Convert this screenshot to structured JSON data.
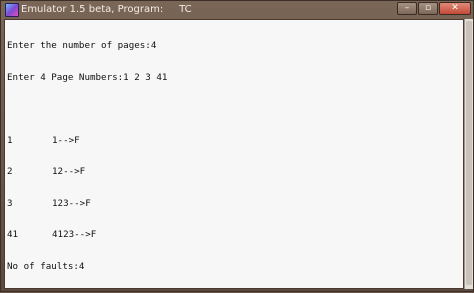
{
  "window": {
    "title": "Emulator 1.5 beta, Program:     TC",
    "controls": {
      "minimize": "–",
      "maximize": "▫",
      "close": "✕"
    }
  },
  "console": {
    "line1": "Enter the number of pages:4",
    "line2": "Enter 4 Page Numbers:1 2 3 41",
    "line3": "",
    "rows": [
      {
        "page": "1",
        "frames": "1-->F"
      },
      {
        "page": "2",
        "frames": "12-->F"
      },
      {
        "page": "3",
        "frames": "123-->F"
      },
      {
        "page": "41",
        "frames": "4123-->F"
      }
    ],
    "faults": "No of faults:4"
  }
}
